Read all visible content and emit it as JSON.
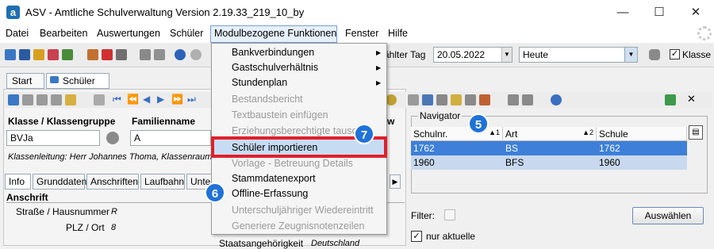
{
  "window": {
    "title": "ASV - Amtliche Schulverwaltung Version 2.19.33_219_10_by",
    "app_icon_letter": "a",
    "minimize": "—",
    "maximize": "☐",
    "close": "✕"
  },
  "menubar": {
    "items": [
      "Datei",
      "Bearbeiten",
      "Auswertungen",
      "Schüler",
      "Modulbezogene Funktionen",
      "Fenster",
      "Hilfe"
    ]
  },
  "toolbar": {
    "date_label": "ählter Tag",
    "date_value": "20.05.2022",
    "period_value": "Heute",
    "klasse_label": "Klasse b",
    "klasse_checked": "✓"
  },
  "doc_tabs": [
    {
      "label": "Start",
      "close": "✕"
    },
    {
      "label": "Schüler",
      "close": "✕"
    }
  ],
  "form": {
    "klasse_label": "Klasse / Klassengruppe",
    "klasse_value": "BVJa",
    "familienname_label": "Familienname",
    "familienname_value": "A",
    "extra_label": "w",
    "klassenleitung": "Klassenleitung: Herr Johannes Thoma, Klassenraum: n/"
  },
  "sub_tabs": [
    "Info",
    "Grunddaten",
    "Anschriften",
    "Laufbahn",
    "Unter"
  ],
  "anschrift": {
    "section": "Anschrift",
    "street_label": "Straße / Hausnummer",
    "street_value": "R",
    "plz_label": "PLZ / Ort",
    "plz_value": "8",
    "staat_label": "Staatsangehörigkeit",
    "staat_value": "Deutschland"
  },
  "navigator": {
    "title": "Navigator",
    "columns": [
      {
        "label": "Schulnr.",
        "sort": "▲1"
      },
      {
        "label": "Art",
        "sort": "▲2"
      },
      {
        "label": "Schule",
        "sort": ""
      }
    ],
    "rows": [
      {
        "schulnr": "1762",
        "art": "BS",
        "schule": "1762"
      },
      {
        "schulnr": "1960",
        "art": "BFS",
        "schule": "1960"
      }
    ],
    "filter_label": "Filter:",
    "select_button": "Auswählen",
    "aktuelle_label": "nur aktuelle",
    "aktuelle_checked": "✓"
  },
  "dropdown": {
    "items": [
      {
        "label": "Bankverbindungen",
        "enabled": true,
        "submenu": true
      },
      {
        "label": "Gastschulverhältnis",
        "enabled": true,
        "submenu": true
      },
      {
        "label": "Stundenplan",
        "enabled": true,
        "submenu": true
      },
      {
        "label": "Bestandsbericht",
        "enabled": false,
        "submenu": false
      },
      {
        "label": "Textbaustein einfügen",
        "enabled": false,
        "submenu": false
      },
      {
        "label": "Erziehungsberechtigte tausche",
        "enabled": false,
        "submenu": false
      },
      {
        "label": "Schüler importieren",
        "enabled": true,
        "submenu": false
      },
      {
        "label": "Vorlage - Betreuung Details",
        "enabled": false,
        "submenu": false
      },
      {
        "label": "Stammdatenexport",
        "enabled": true,
        "submenu": false
      },
      {
        "label": "Offline-Erfassung",
        "enabled": true,
        "submenu": false
      },
      {
        "label": "Unterschuljähriger Wiedereintritt",
        "enabled": false,
        "submenu": false
      },
      {
        "label": "Generiere Zeugnisnotenzeilen",
        "enabled": false,
        "submenu": false
      }
    ],
    "submenu_arrow": "▶"
  },
  "badges": {
    "five": "5",
    "six": "6",
    "seven": "7"
  },
  "colors": {
    "highlight_box": "#e0202a",
    "badge": "#1f72d8",
    "selected_row": "#3d7fd9"
  }
}
